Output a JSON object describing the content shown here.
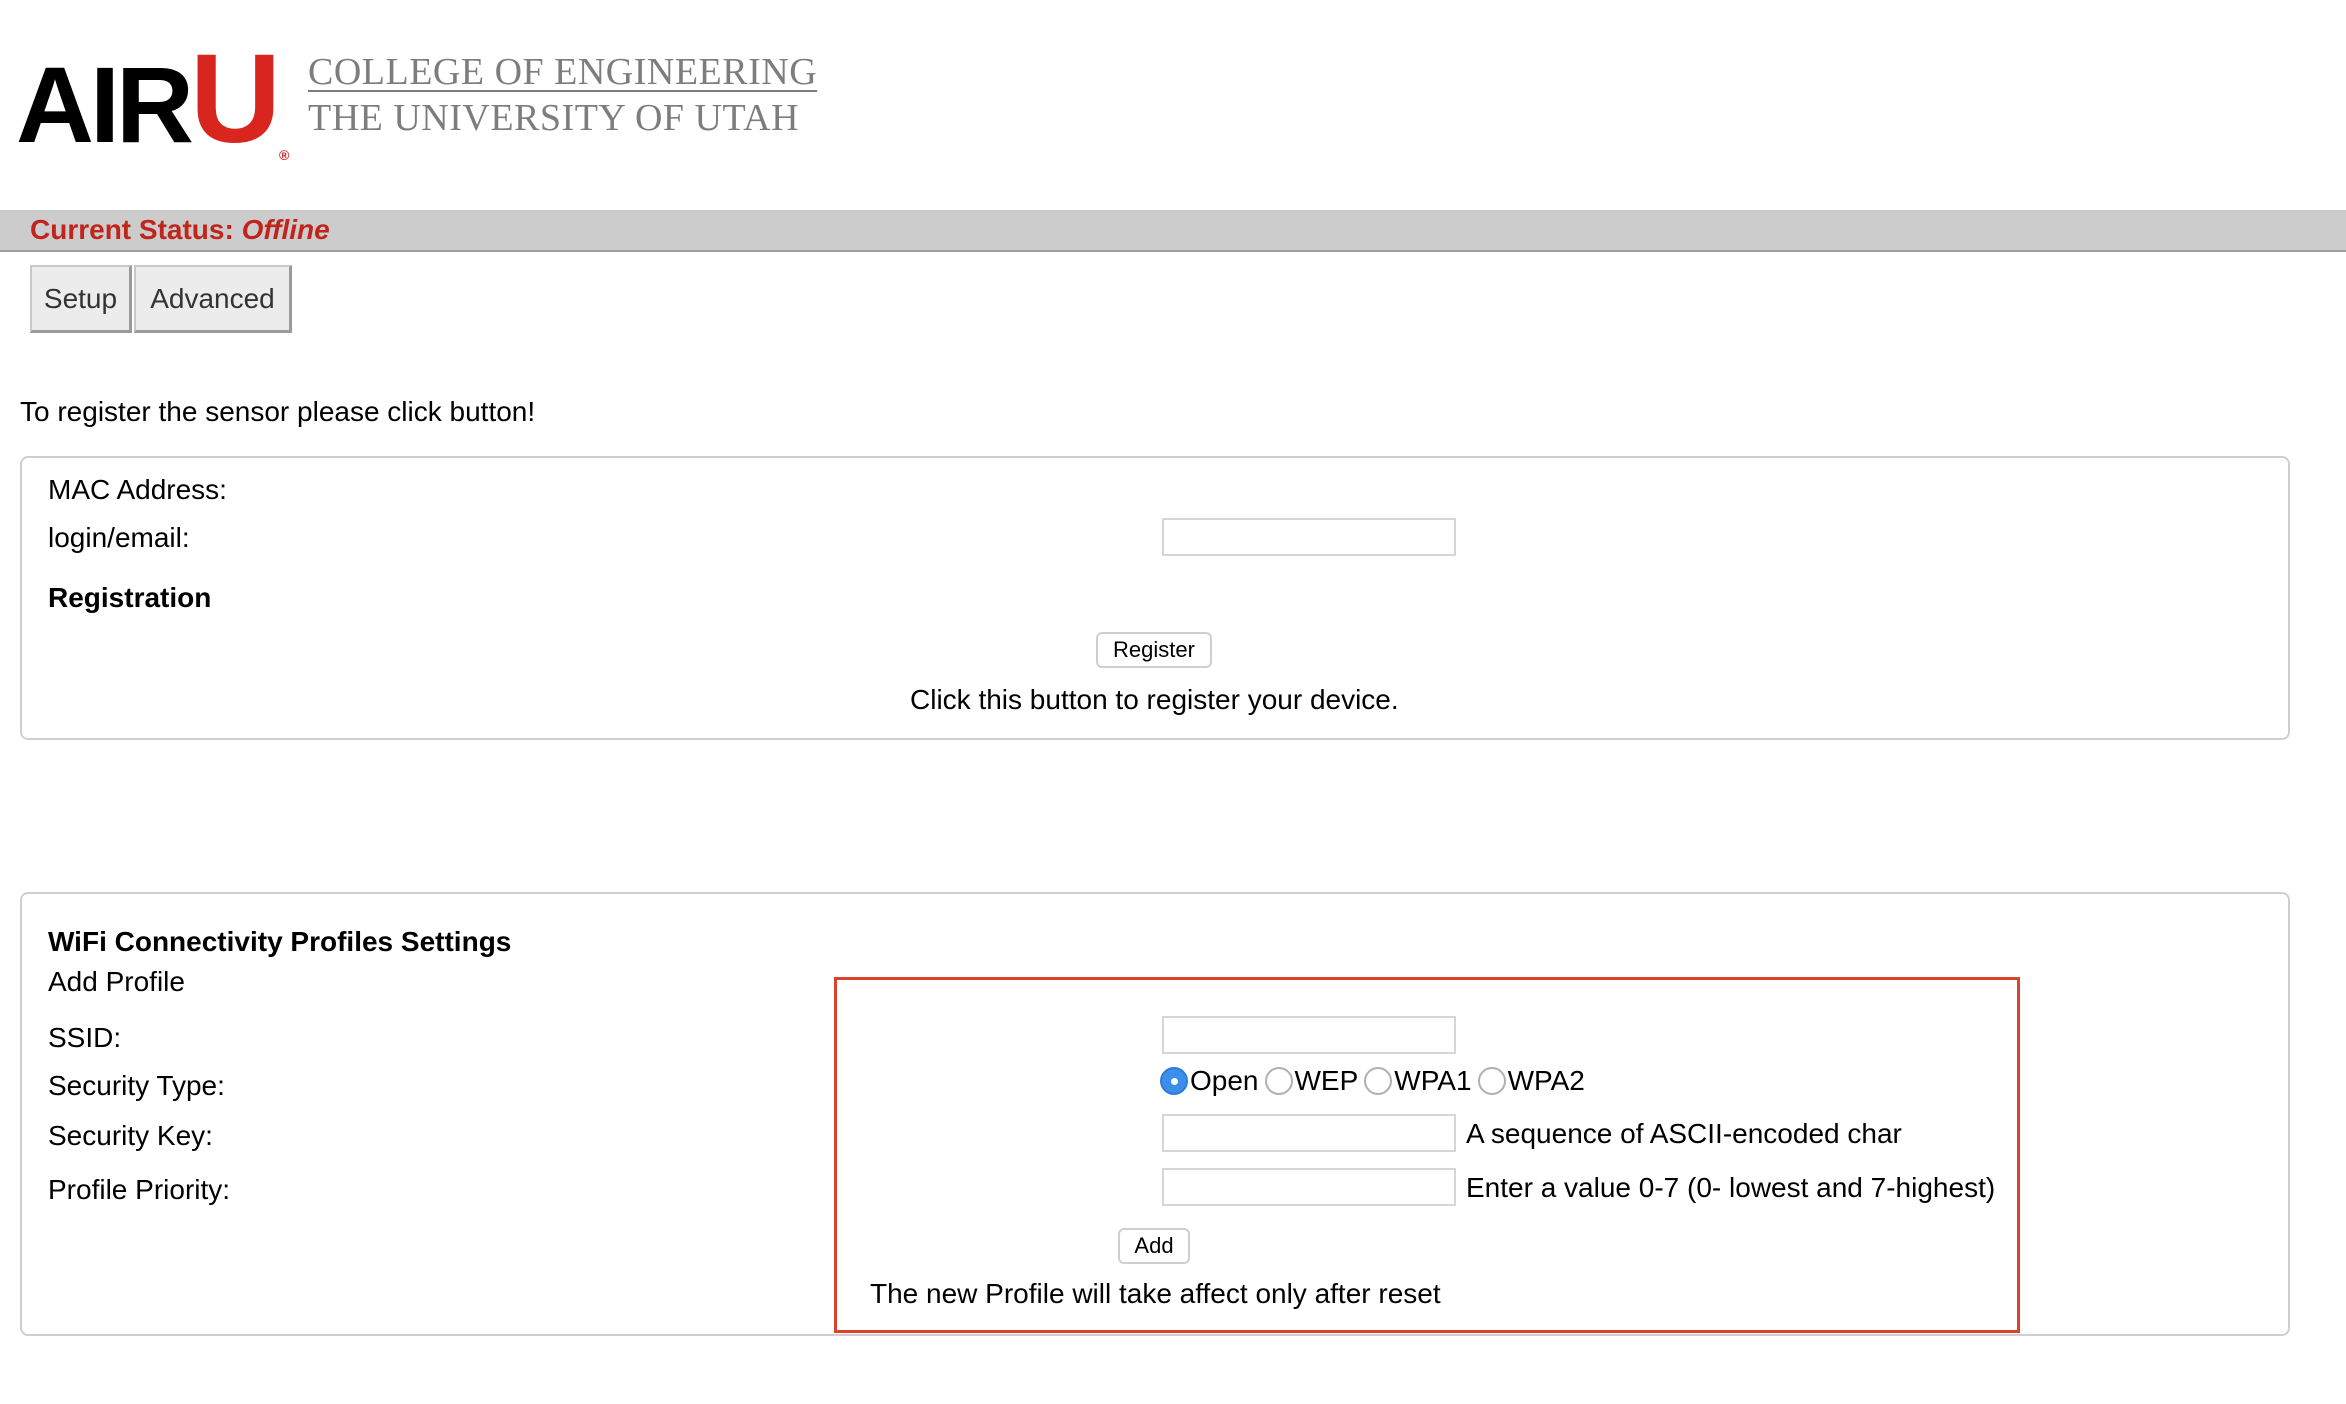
{
  "logo": {
    "mark_text": "AIR",
    "mark_u": "U",
    "registered": "®",
    "line1": "COLLEGE OF ENGINEERING",
    "line2": "THE UNIVERSITY OF UTAH",
    "accent_color": "#d8261f"
  },
  "status": {
    "label": "Current Status: ",
    "value": "Offline",
    "color": "#c1241b"
  },
  "tabs": [
    {
      "label": "Setup"
    },
    {
      "label": "Advanced"
    }
  ],
  "intro": "To register the sensor please click button!",
  "registration_panel": {
    "mac_label": "MAC Address:",
    "login_label": "login/email:",
    "login_value": "",
    "heading": "Registration",
    "register_button": "Register",
    "hint": "Click this button to register your device."
  },
  "wifi_panel": {
    "heading": "WiFi Connectivity Profiles Settings",
    "subheading": "Add Profile",
    "ssid_label": "SSID:",
    "ssid_value": "",
    "security_type_label": "Security Type:",
    "security_options": [
      {
        "label": "Open",
        "checked": true
      },
      {
        "label": "WEP",
        "checked": false
      },
      {
        "label": "WPA1",
        "checked": false
      },
      {
        "label": "WPA2",
        "checked": false
      }
    ],
    "security_key_label": "Security Key:",
    "security_key_value": "",
    "security_key_hint": "A sequence of ASCII-encoded char",
    "priority_label": "Profile Priority:",
    "priority_value": "",
    "priority_hint": "Enter a value 0-7 (0- lowest and 7-highest)",
    "add_button": "Add",
    "note": "The new Profile will take affect only after reset",
    "highlight_color": "#d9432b"
  }
}
